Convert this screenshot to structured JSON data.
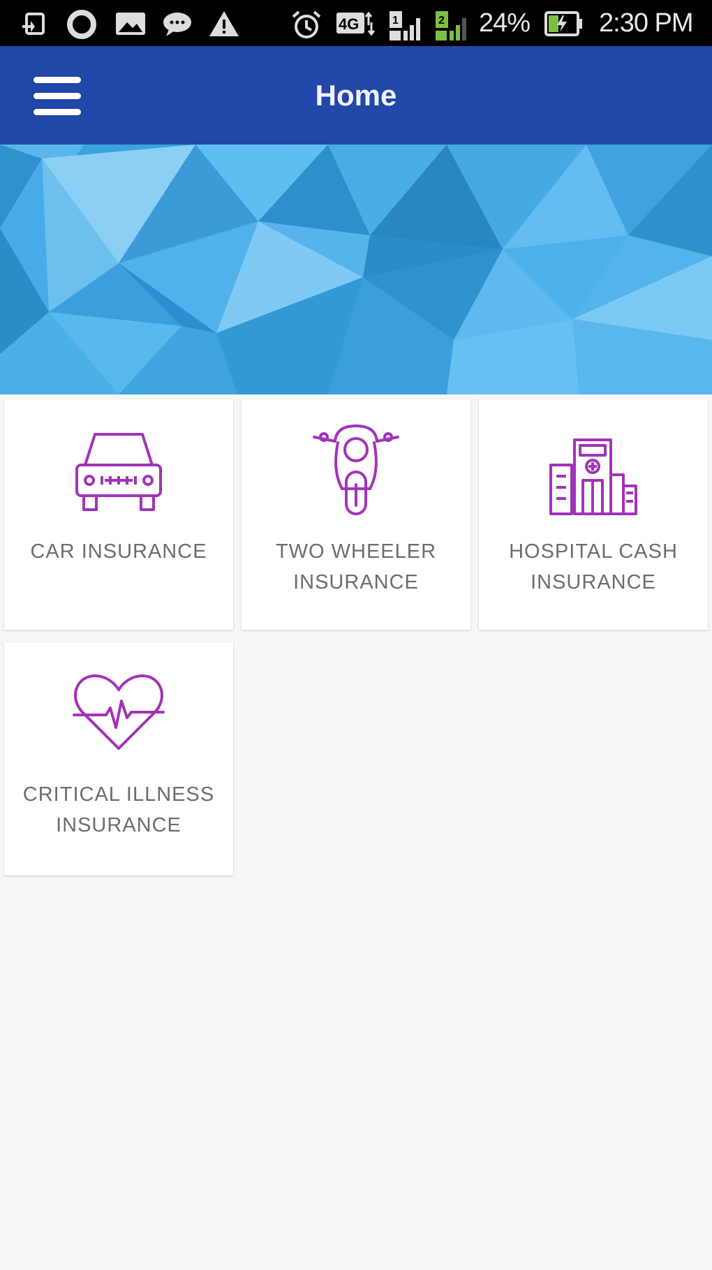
{
  "status_bar": {
    "battery": "24%",
    "time": "2:30 PM",
    "icons": [
      "screenshot-icon",
      "circle-app-icon",
      "image-icon",
      "chat-icon",
      "warning-icon",
      "alarm-icon",
      "lte-icon",
      "signal-icon",
      "data-signal-icon",
      "battery-charging-icon"
    ]
  },
  "app_bar": {
    "title": "Home",
    "menu_icon": "hamburger-menu-icon",
    "background": "#2148a8"
  },
  "banner": {
    "page_count": 1,
    "active_page": 1
  },
  "tiles": [
    {
      "line1": "CAR INSURANCE",
      "line2": "",
      "icon": "car-icon"
    },
    {
      "line1": "TWO WHEELER",
      "line2": "INSURANCE",
      "icon": "motorcycle-icon"
    },
    {
      "line1": "HOSPITAL CASH",
      "line2": "INSURANCE",
      "icon": "hospital-icon"
    },
    {
      "line1": "CRITICAL ILLNESS",
      "line2": "INSURANCE",
      "icon": "heart-pulse-icon"
    }
  ],
  "colors": {
    "icon_accent": "#a233b8",
    "label_text": "#6c6c6c",
    "background": "#f7f7f7"
  }
}
